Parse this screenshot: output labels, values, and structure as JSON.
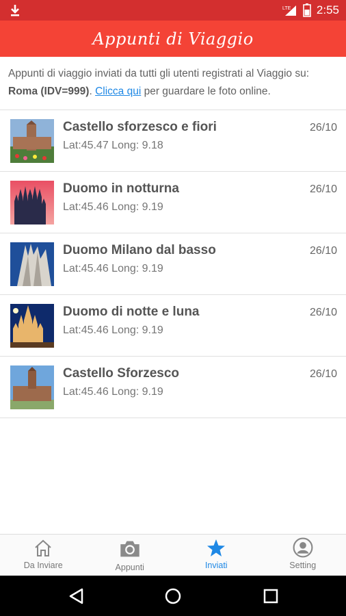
{
  "status_bar": {
    "time": "2:55",
    "network": "LTE"
  },
  "app_bar": {
    "title": "Appunti di Viaggio"
  },
  "intro": {
    "text_before": "Appunti di viaggio inviati da tutti gli utenti registrati al Viaggio su: ",
    "trip": "Roma (IDV=999)",
    "text_mid": ". ",
    "link": "Clicca qui",
    "text_after": " per guardare le foto online."
  },
  "items": [
    {
      "title": "Castello sforzesco e fiori",
      "coords": "Lat:45.47 Long: 9.18",
      "date": "26/10"
    },
    {
      "title": "Duomo in notturna",
      "coords": "Lat:45.46 Long: 9.19",
      "date": "26/10"
    },
    {
      "title": "Duomo Milano dal basso",
      "coords": "Lat:45.46 Long: 9.19",
      "date": "26/10"
    },
    {
      "title": "Duomo di notte e luna",
      "coords": "Lat:45.46 Long: 9.19",
      "date": "26/10"
    },
    {
      "title": "Castello Sforzesco",
      "coords": "Lat:45.46 Long: 9.19",
      "date": "26/10"
    }
  ],
  "bottom_nav": {
    "tabs": [
      {
        "label": "Da Inviare",
        "icon": "home-icon"
      },
      {
        "label": "Appunti",
        "icon": "camera-icon"
      },
      {
        "label": "Inviati",
        "icon": "star-icon",
        "active": true
      },
      {
        "label": "Setting",
        "icon": "person-icon"
      }
    ]
  },
  "colors": {
    "app_bar": "#f44336",
    "status_bar": "#d32f2f",
    "accent": "#1e88e5"
  }
}
